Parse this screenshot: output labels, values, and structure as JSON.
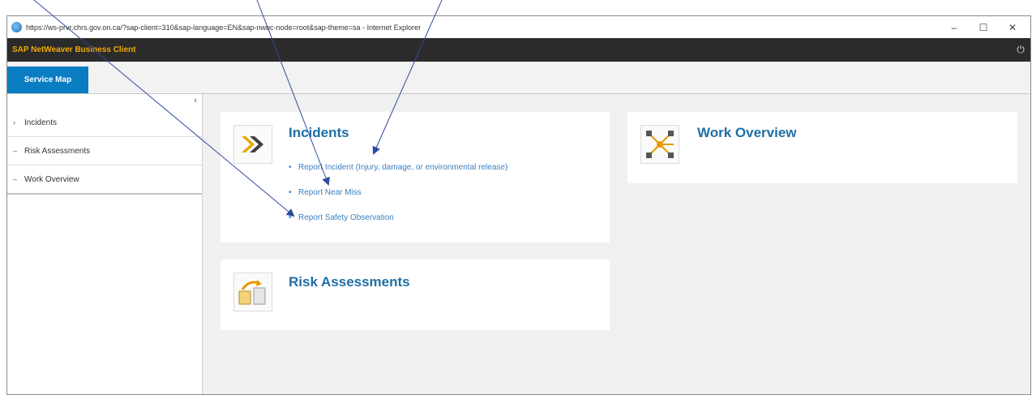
{
  "window": {
    "url": "https://ws-prvr.chrs.gov.on.ca/?sap-client=310&sap-language=EN&sap-nwbc-node=root&sap-theme=sa - Internet Explorer",
    "minimize": "–",
    "maximize": "☐",
    "close": "✕"
  },
  "app": {
    "name": "SAP NetWeaver Business Client"
  },
  "tabs": [
    {
      "label": "Service Map"
    }
  ],
  "sidebar": {
    "collapse_glyph": "‹",
    "items": [
      {
        "marker": "›",
        "label": "Incidents"
      },
      {
        "marker": "–",
        "label": "Risk Assessments"
      },
      {
        "marker": "–",
        "label": "Work Overview"
      }
    ]
  },
  "cards": {
    "incidents": {
      "title": "Incidents",
      "links": [
        "Report Incident (Injury, damage, or environmental release)",
        "Report Near Miss",
        "Report Safety Observation"
      ]
    },
    "risk": {
      "title": "Risk Assessments"
    },
    "work": {
      "title": "Work Overview"
    }
  },
  "colors": {
    "accent": "#0a7cc1",
    "header_bg": "#2b2b2b",
    "brand_text": "#f0ab00",
    "link": "#3b7fbf",
    "arrow": "#2e4a9e"
  },
  "icons": [
    "ie-icon",
    "power-icon",
    "chevron-right-icon",
    "dash-icon",
    "network-icon",
    "transfer-icon"
  ]
}
